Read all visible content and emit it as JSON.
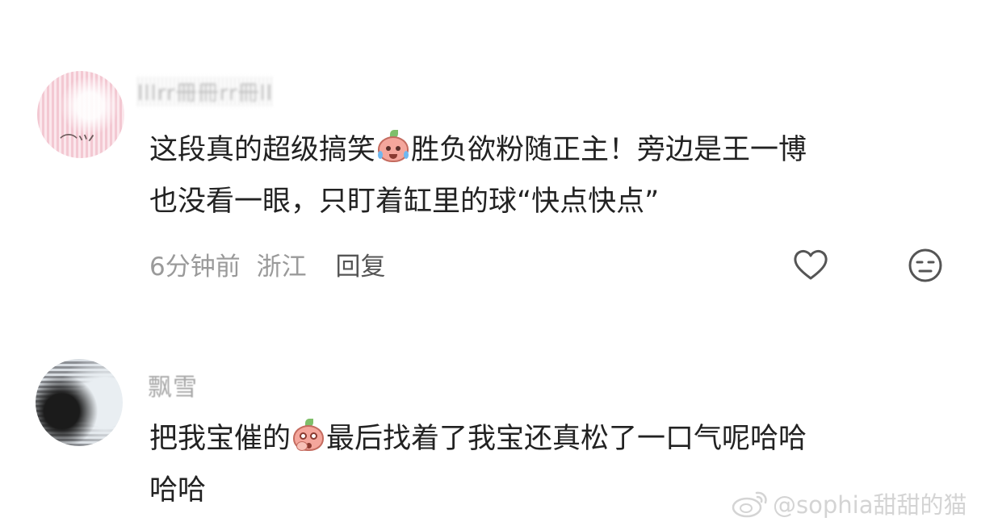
{
  "comments": [
    {
      "username": "lllrr冊冊rr冊ll",
      "text_part1": "这段真的超级搞笑",
      "emoji": "crying-laugh-peach-emoji",
      "text_part2": "胜负欲粉随正主！旁边是王一博",
      "text_line2": "也没看一眼，只盯着缸里的球“快点快点”",
      "time": "6分钟前",
      "location": "浙江",
      "reply_label": "回复"
    },
    {
      "username": "飘雪",
      "text_part1": "把我宝催的",
      "emoji": "shocked-peach-emoji",
      "text_part2": "最后找着了我宝还真松了一口气呢哈哈",
      "text_line2": "哈哈"
    }
  ],
  "watermark": {
    "text": "@sophia甜甜的猫"
  },
  "icons": {
    "like": "heart-outline-icon",
    "dislike": "neutral-face-icon",
    "watermark_logo": "weibo-logo-icon"
  },
  "colors": {
    "text": "#222222",
    "meta": "#9a9a9a",
    "reply": "#555555",
    "icon_stroke": "#555555",
    "watermark": "#d4d4d4"
  }
}
